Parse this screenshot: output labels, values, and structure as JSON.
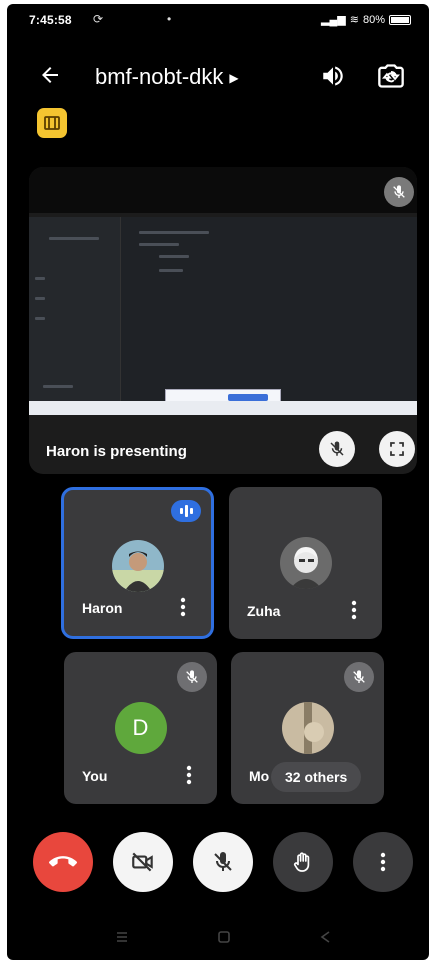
{
  "status_bar": {
    "time": "7:45:58",
    "battery": "80%"
  },
  "header": {
    "meeting_code": "bmf-nobt-dkk",
    "icons": [
      "back-arrow-icon",
      "chevron-right-icon",
      "speaker-icon",
      "switch-camera-icon"
    ]
  },
  "presentation": {
    "label": "Haron is presenting"
  },
  "participants": [
    {
      "name": "Haron",
      "state": "speaking",
      "avatar": "photo"
    },
    {
      "name": "Zuha",
      "state": "video-off",
      "avatar": "photo"
    },
    {
      "name": "You",
      "state": "muted",
      "avatar": "letter",
      "letter": "D"
    },
    {
      "name": "Mo",
      "state": "muted",
      "avatar": "photo",
      "others_label": "32 others"
    }
  ],
  "controls": [
    "end-call",
    "camera-off",
    "mic-off",
    "raise-hand",
    "more-options"
  ],
  "colors": {
    "end_call": "#e8473d",
    "active_speaker": "#2f6fe0",
    "avatar_you": "#5fa83c",
    "activity_badge": "#f4c430"
  }
}
